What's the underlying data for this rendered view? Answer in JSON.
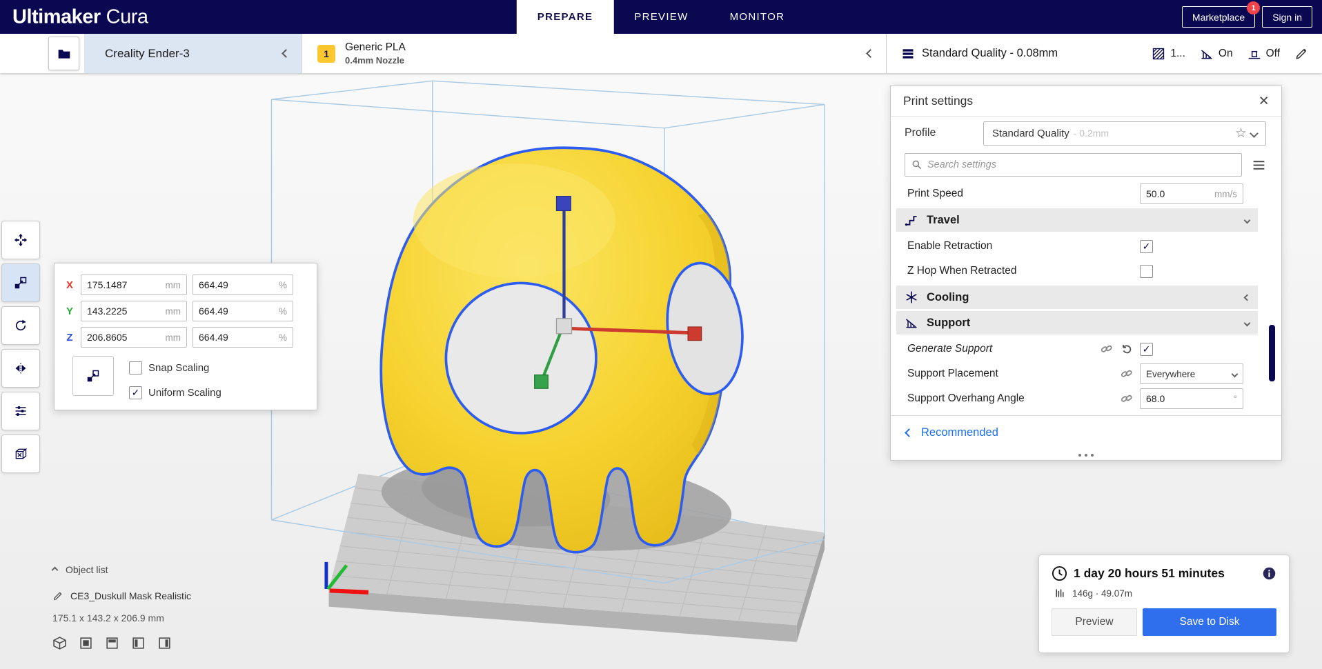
{
  "colors": {
    "accent": "#196ef0",
    "brand_navy": "#0a0850",
    "extruder_yellow": "#fdc72f",
    "badge_red": "#f2434b",
    "selection_blue": "#2c5cf2",
    "model_yellow": "#f6d22e"
  },
  "icons": {
    "close": "×",
    "star": "☆"
  },
  "header": {
    "logo_bold": "Ultimaker",
    "logo_light": "Cura",
    "tabs": [
      {
        "label": "PREPARE",
        "active": true
      },
      {
        "label": "PREVIEW",
        "active": false
      },
      {
        "label": "MONITOR",
        "active": false
      }
    ],
    "marketplace": {
      "label": "Marketplace",
      "badge": "1"
    },
    "signin": {
      "label": "Sign in"
    }
  },
  "configbar": {
    "printer": {
      "name": "Creality Ender-3"
    },
    "material": {
      "extruder": "1",
      "name": "Generic PLA",
      "nozzle": "0.4mm Nozzle"
    },
    "summary": {
      "profile": "Standard Quality - 0.08mm",
      "infill": "1...",
      "support": "On",
      "adhesion": "Off"
    }
  },
  "scale_panel": {
    "axes": [
      {
        "axis": "X",
        "mm": "175.1487",
        "pct": "664.49"
      },
      {
        "axis": "Y",
        "mm": "143.2225",
        "pct": "664.49"
      },
      {
        "axis": "Z",
        "mm": "206.8605",
        "pct": "664.49"
      }
    ],
    "unit_mm": "mm",
    "unit_pct": "%",
    "snap": {
      "label": "Snap Scaling",
      "checked": false
    },
    "uniform": {
      "label": "Uniform Scaling",
      "checked": true
    }
  },
  "print_settings": {
    "title": "Print settings",
    "profile": {
      "label": "Profile",
      "value": "Standard Quality",
      "hint": "- 0.2mm"
    },
    "search": {
      "placeholder": "Search settings"
    },
    "print_speed": {
      "label": "Print Speed",
      "value": "50.0",
      "unit": "mm/s"
    },
    "sections": {
      "travel": {
        "label": "Travel"
      },
      "cooling": {
        "label": "Cooling"
      },
      "support": {
        "label": "Support"
      }
    },
    "rows": {
      "enable_retraction": {
        "label": "Enable Retraction",
        "checked": true
      },
      "z_hop": {
        "label": "Z Hop When Retracted",
        "checked": false
      },
      "generate_support": {
        "label": "Generate Support",
        "checked": true
      },
      "support_placement": {
        "label": "Support Placement",
        "value": "Everywhere"
      },
      "support_overhang": {
        "label": "Support Overhang Angle",
        "value": "68.0",
        "unit": "°"
      }
    },
    "recommended_label": "Recommended"
  },
  "object_list": {
    "toggle_label": "Object list",
    "name": "CE3_Duskull Mask Realistic",
    "dimensions": "175.1 x 143.2 x 206.9 mm"
  },
  "output": {
    "time": "1 day 20 hours 51 minutes",
    "material": "146g · 49.07m",
    "preview_label": "Preview",
    "save_label": "Save to Disk"
  }
}
